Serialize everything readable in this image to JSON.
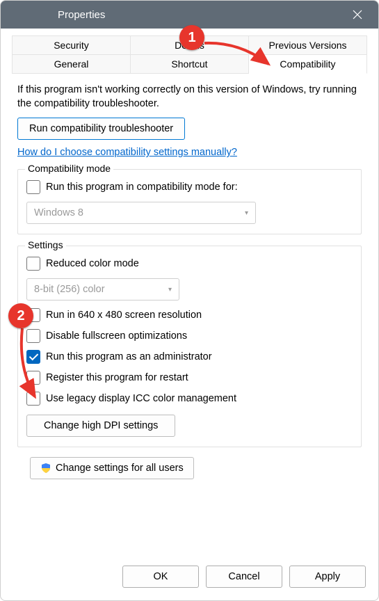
{
  "titlebar": {
    "title": "Properties"
  },
  "tabs": {
    "row1": [
      "Security",
      "Details",
      "Previous Versions"
    ],
    "row2": [
      "General",
      "Shortcut",
      "Compatibility"
    ],
    "active": "Compatibility"
  },
  "intro": "If this program isn't working correctly on this version of Windows, try running the compatibility troubleshooter.",
  "troubleshoot_btn": "Run compatibility troubleshooter",
  "help_link": "How do I choose compatibility settings manually?",
  "compat_mode": {
    "legend": "Compatibility mode",
    "checkbox": "Run this program in compatibility mode for:",
    "select_value": "Windows 8"
  },
  "settings": {
    "legend": "Settings",
    "reduced_color": "Reduced color mode",
    "color_select": "8-bit (256) color",
    "run_640": "Run in 640 x 480 screen resolution",
    "disable_fs": "Disable fullscreen optimizations",
    "run_admin": "Run this program as an administrator",
    "register_restart": "Register this program for restart",
    "legacy_icc": "Use legacy display ICC color management",
    "dpi_btn": "Change high DPI settings"
  },
  "all_users_btn": "Change settings for all users",
  "footer": {
    "ok": "OK",
    "cancel": "Cancel",
    "apply": "Apply"
  },
  "annotations": {
    "a1": "1",
    "a2": "2"
  }
}
